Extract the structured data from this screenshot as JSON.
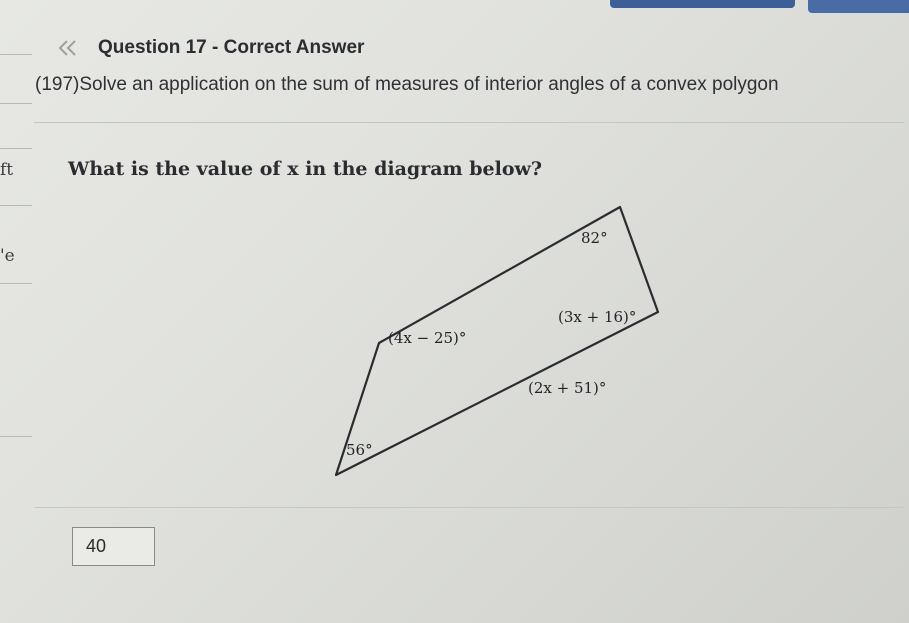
{
  "header": {
    "back_icon": "double-chevron-left-icon",
    "title": "Question 17 - Correct Answer"
  },
  "subtitle": "(197)Solve an application on the sum of measures of interior angles of a convex polygon",
  "question": {
    "prompt": "What is the value of x in the diagram below?"
  },
  "diagram": {
    "shape": "quadrilateral",
    "angles": {
      "top_right": "82°",
      "right": "(3x + 16)°",
      "left_top": "(4x − 25)°",
      "inner_bottom_right": "(2x + 51)°",
      "bottom_left": "56°"
    }
  },
  "answer": {
    "value": "40"
  },
  "left_rail": {
    "fragment_1": "ft",
    "fragment_2": "'e"
  },
  "colors": {
    "accent": "#3d5f98",
    "background": "#e1e2de",
    "text": "#2a2b2e"
  }
}
